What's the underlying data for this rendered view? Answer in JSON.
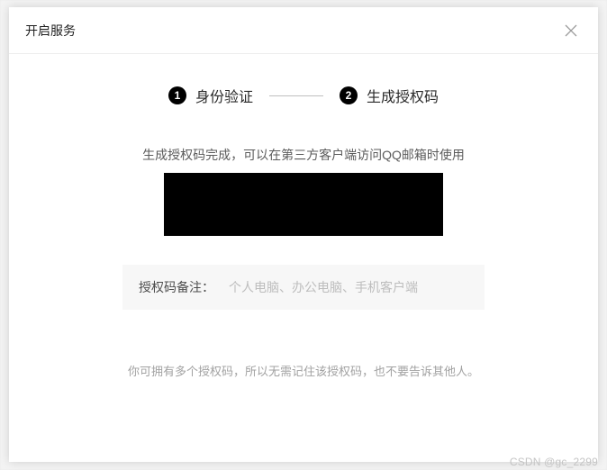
{
  "modal": {
    "title": "开启服务",
    "close_icon": "close-icon"
  },
  "steps": {
    "step1": {
      "num": "1",
      "label": "身份验证"
    },
    "step2": {
      "num": "2",
      "label": "生成授权码"
    }
  },
  "main": {
    "desc": "生成授权码完成，可以在第三方客户端访问QQ邮箱时使用",
    "auth_code_value": "",
    "remark_label": "授权码备注：",
    "remark_placeholder": "个人电脑、办公电脑、手机客户端",
    "note": "你可拥有多个授权码，所以无需记住该授权码，也不要告诉其他人。"
  },
  "watermark": "CSDN @gc_2299"
}
